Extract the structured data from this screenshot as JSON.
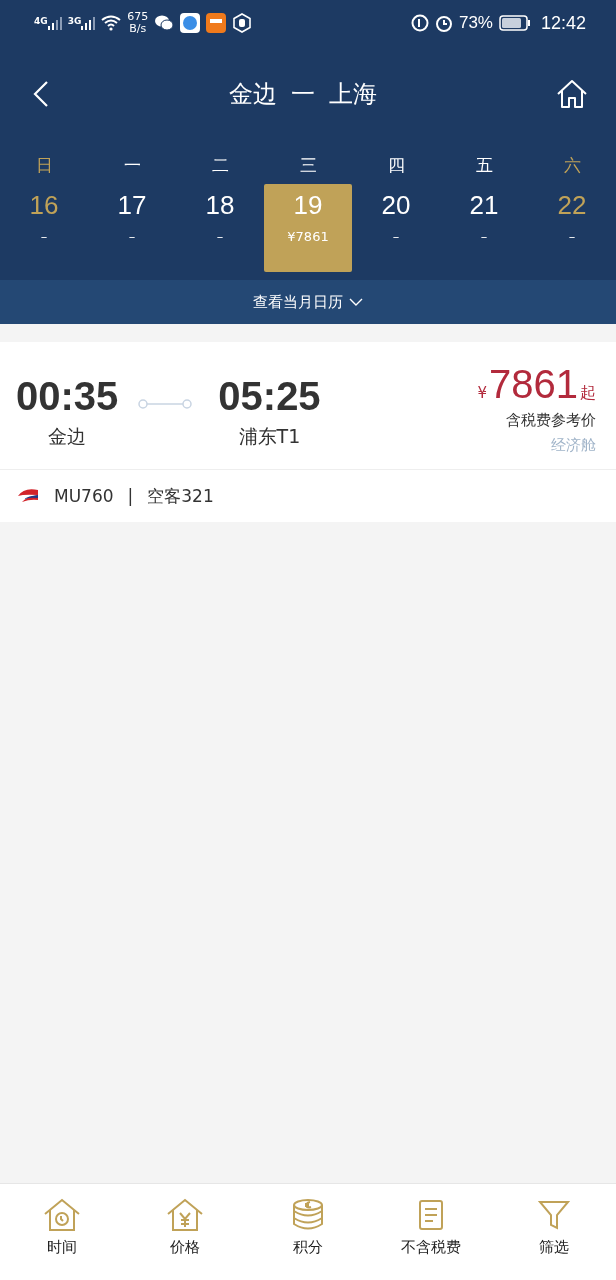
{
  "status_bar": {
    "signal_1": "4G",
    "signal_2": "3G",
    "speed": "675",
    "speed_unit": "B/s",
    "battery": "73%",
    "time": "12:42"
  },
  "header": {
    "title_from": "金边",
    "title_sep": "一",
    "title_to": "上海"
  },
  "days": [
    {
      "weekday": "日",
      "date": "16",
      "price": "–",
      "selected": false,
      "weekend": true
    },
    {
      "weekday": "一",
      "date": "17",
      "price": "–",
      "selected": false,
      "weekend": false
    },
    {
      "weekday": "二",
      "date": "18",
      "price": "–",
      "selected": false,
      "weekend": false
    },
    {
      "weekday": "三",
      "date": "19",
      "price": "¥7861",
      "selected": true,
      "weekend": false
    },
    {
      "weekday": "四",
      "date": "20",
      "price": "–",
      "selected": false,
      "weekend": false
    },
    {
      "weekday": "五",
      "date": "21",
      "price": "–",
      "selected": false,
      "weekend": false
    },
    {
      "weekday": "六",
      "date": "22",
      "price": "–",
      "selected": false,
      "weekend": true
    }
  ],
  "calendar_link": "查看当月日历",
  "flights": [
    {
      "depart_time": "00:35",
      "depart_airport": "金边",
      "arrive_time": "05:25",
      "arrive_airport": "浦东T1",
      "currency": "¥",
      "price": "7861",
      "price_suffix": "起",
      "price_note": "含税费参考价",
      "cabin": "经济舱",
      "flight_no": "MU760",
      "separator": "|",
      "aircraft": "空客321"
    }
  ],
  "bottom_tabs": [
    {
      "kind": "time",
      "label": "时间"
    },
    {
      "kind": "price",
      "label": "价格"
    },
    {
      "kind": "points",
      "label": "积分"
    },
    {
      "kind": "tax",
      "label": "不含税费"
    },
    {
      "kind": "filter",
      "label": "筛选"
    }
  ]
}
